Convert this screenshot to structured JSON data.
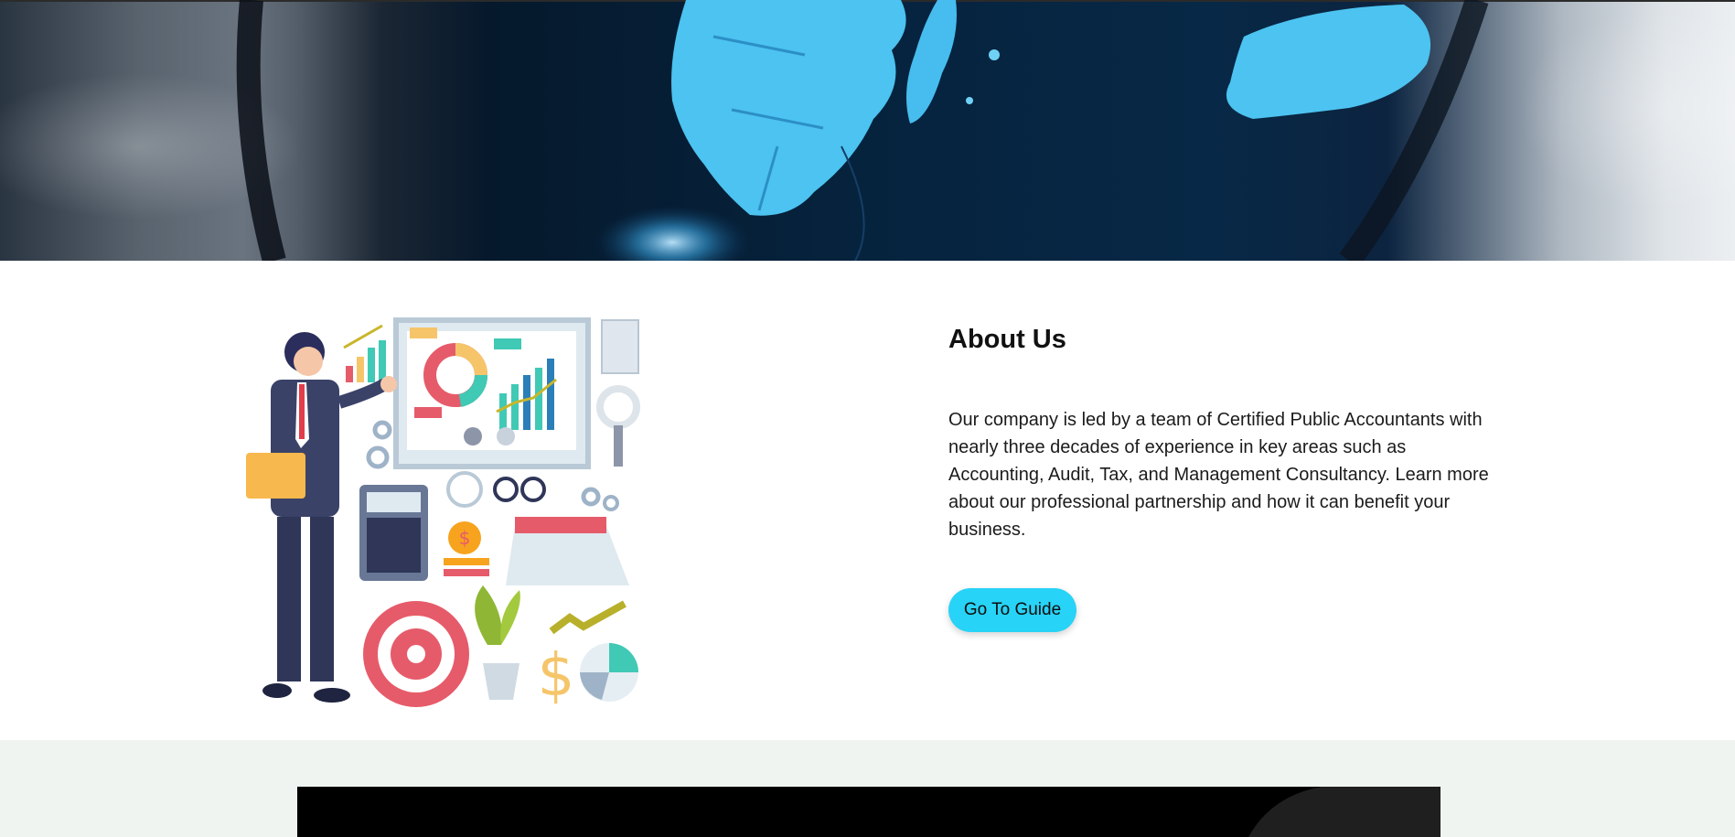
{
  "hero": {
    "image": "globe-photo"
  },
  "about": {
    "illustration": "accountant-business-illustration",
    "title": "About Us",
    "description": "Our company is led by a team of Certified Public Accountants with nearly three decades of experience in key areas such as Accounting, Audit, Tax, and Management Consultancy. Learn more about our professional partnership and how it can benefit your business.",
    "cta_label": "Go To Guide"
  },
  "colors": {
    "cta_background": "#27d3f6",
    "section_background": "#f0f4f1",
    "video_background": "#000000"
  }
}
